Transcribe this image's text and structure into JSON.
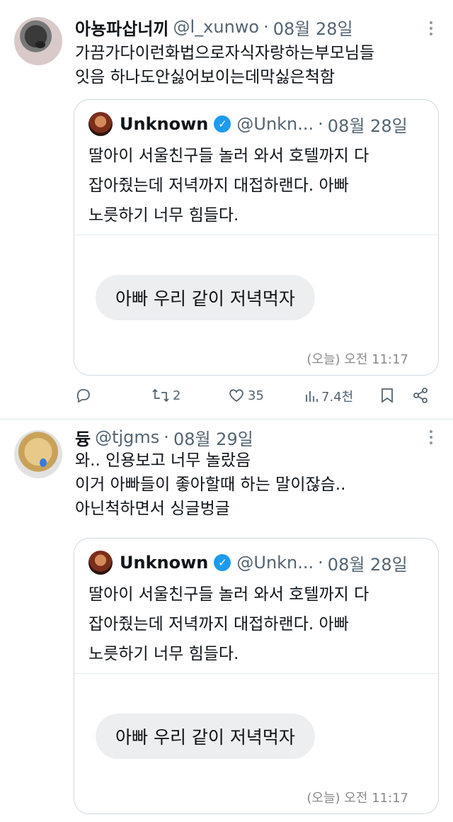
{
  "posts": [
    {
      "display_name": "아뇽파삽너끼",
      "handle": "@l_xunwo",
      "separator": "·",
      "date": "08월 28일",
      "text_lines": [
        "가끔가다이런화법으로자식자랑하는부모님들",
        "잇음 하나도안싫어보이는데막싫은척함"
      ],
      "quote": {
        "display_name": "Unknown",
        "handle": "@Unkn...",
        "separator": "·",
        "date": "08월 28일",
        "text_lines": [
          "딸아이 서울친구들 놀러 와서 호텔까지 다",
          "잡아줬는데 저녁까지 대접하랜다. 아빠",
          "노릇하기 너무 힘들다."
        ],
        "bubble_text": "아빠 우리 같이 저녁먹자",
        "timestamp": "(오늘) 오전 11:17"
      },
      "actions": {
        "reply_icon": "reply-icon",
        "retweet_icon": "retweet-icon",
        "retweet_count": "2",
        "like_icon": "heart-icon",
        "like_count": "35",
        "views_icon": "views-icon",
        "views_count": "7.4천",
        "bookmark_icon": "bookmark-icon",
        "share_icon": "share-icon"
      }
    },
    {
      "display_name": "듕",
      "handle": "@tjgms",
      "separator": "·",
      "date": "08월 29일",
      "text_lines": [
        "와.. 인용보고 너무 놀랐음",
        "이거 아빠들이 좋아할때 하는 말이잖슴..",
        "아닌척하면서 싱글벙글"
      ],
      "quote": {
        "display_name": "Unknown",
        "handle": "@Unkn...",
        "separator": "·",
        "date": "08월 28일",
        "text_lines": [
          "딸아이 서울친구들 놀러 와서 호텔까지 다",
          "잡아줬는데 저녁까지 대접하랜다. 아빠",
          "노릇하기 너무 힘들다."
        ],
        "bubble_text": "아빠 우리 같이 저녁먹자",
        "timestamp": "(오늘) 오전 11:17"
      }
    }
  ],
  "colors": {
    "text_primary": "#0f1419",
    "text_secondary": "#536471",
    "verified_blue": "#1d9bf0",
    "border": "#cfd9de",
    "bubble": "#eceef0"
  }
}
